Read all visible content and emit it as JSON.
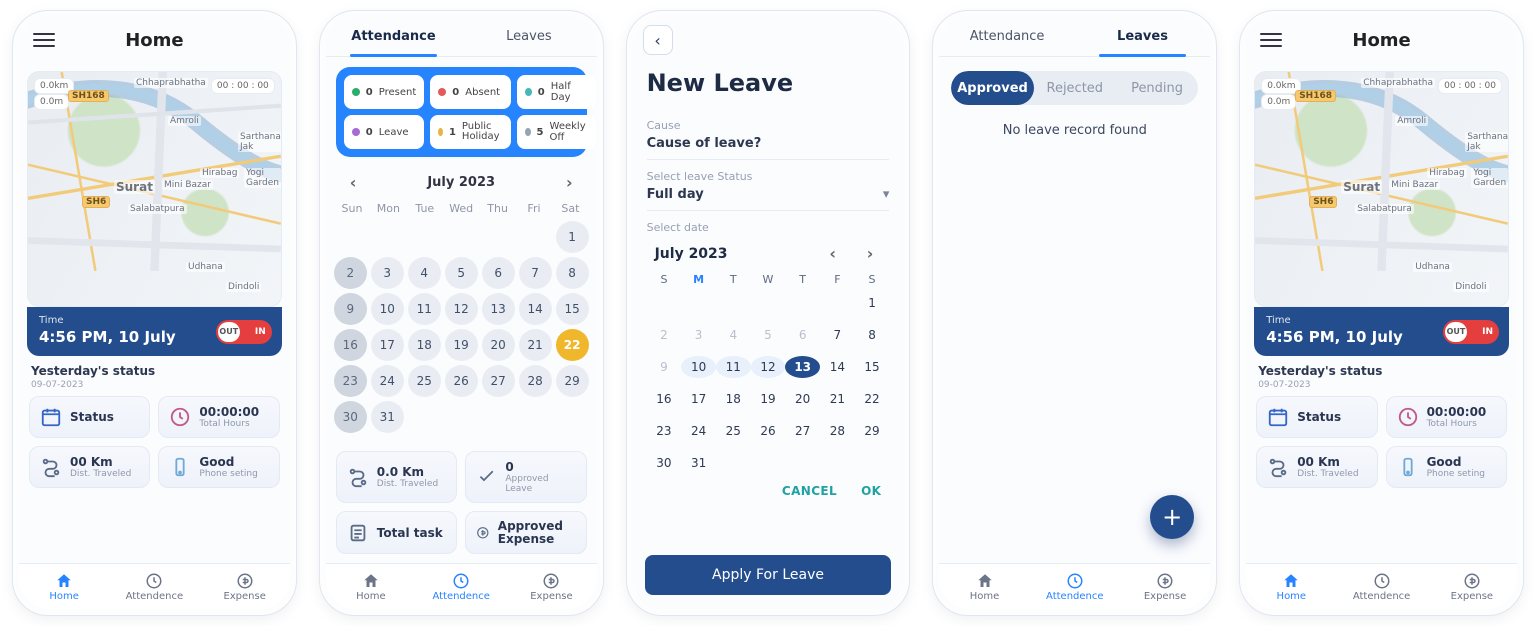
{
  "s1": {
    "title": "Home",
    "map": {
      "km": "0.0km",
      "m": "0.0m",
      "timer": "00 : 00 : 00",
      "labels": {
        "sh168": "SH168",
        "sh6": "SH6",
        "amroli": "Amroli",
        "sarthana": "Sarthana Jak",
        "hirabag": "Hirabag",
        "yogi": "Yogi Garden",
        "surat": "Surat",
        "mini": "Mini Bazar",
        "salabat": "Salabatpura",
        "udhana": "Udhana",
        "dindoli": "Dindoli",
        "chhapra": "Chhaprabhatha"
      }
    },
    "timebar": {
      "label": "Time",
      "value": "4:56 PM, 10 July",
      "out": "OUT",
      "in": "IN"
    },
    "ystatus": {
      "title": "Yesterday's status",
      "date": "09-07-2023"
    },
    "stats": {
      "status": {
        "t": "Status"
      },
      "hours": {
        "t": "00:00:00",
        "s": "Total Hours"
      },
      "km": {
        "t": "00 Km",
        "s": "Dist. Traveled"
      },
      "phone": {
        "t": "Good",
        "s": "Phone seting"
      }
    },
    "nav": {
      "home": "Home",
      "att": "Attendence",
      "exp": "Expense"
    }
  },
  "s2": {
    "tabs": {
      "att": "Attendance",
      "leaves": "Leaves"
    },
    "legend": [
      {
        "n": "0",
        "l": "Present",
        "cls": "present"
      },
      {
        "n": "0",
        "l": "Absent",
        "cls": "absent"
      },
      {
        "n": "0",
        "l": "Half Day",
        "cls": "half"
      },
      {
        "n": "0",
        "l": "Leave",
        "cls": "leave"
      },
      {
        "n": "1",
        "l": "Public Holiday",
        "cls": "holiday"
      },
      {
        "n": "5",
        "l": "Weekly Off",
        "cls": "woff"
      }
    ],
    "month": "July 2023",
    "dow": [
      "Sun",
      "Mon",
      "Tue",
      "Wed",
      "Thu",
      "Fri",
      "Sat"
    ],
    "cards": {
      "dist": {
        "t": "0.0 Km",
        "s": "Dist. Traveled"
      },
      "aleave": {
        "t": "0",
        "s": "Approved Leave"
      },
      "task": {
        "t": "Total task"
      },
      "aexp": {
        "t": "Approved Expense"
      }
    },
    "nav": {
      "home": "Home",
      "att": "Attendence",
      "exp": "Expense"
    }
  },
  "s3": {
    "title": "New Leave",
    "cause_lbl": "Cause",
    "cause_val": "Cause of leave?",
    "status_lbl": "Select leave Status",
    "status_val": "Full day",
    "date_lbl": "Select date",
    "month": "July 2023",
    "dow": [
      "S",
      "M",
      "T",
      "W",
      "T",
      "F",
      "S"
    ],
    "buttons": {
      "cancel": "CANCEL",
      "ok": "OK",
      "apply": "Apply For Leave"
    }
  },
  "s4": {
    "tabs": {
      "att": "Attendance",
      "leaves": "Leaves"
    },
    "seg": {
      "approved": "Approved",
      "rejected": "Rejected",
      "pending": "Pending"
    },
    "empty": "No leave record found",
    "nav": {
      "home": "Home",
      "att": "Attendence",
      "exp": "Expense"
    }
  }
}
